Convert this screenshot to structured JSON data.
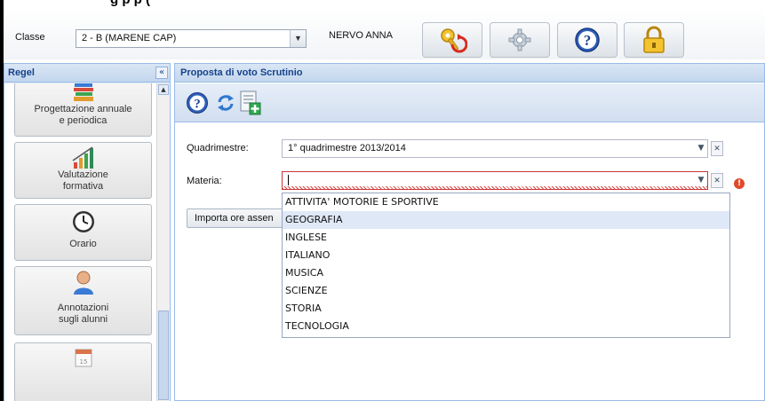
{
  "top_strip": {
    "text": "g          p                              p  ("
  },
  "header": {
    "classe_label": "Classe",
    "classe_value": "2 - B (MARENE CAP)",
    "teacher_name": "NERVO ANNA"
  },
  "left_panel": {
    "title": "Regel",
    "collapse": "«",
    "items": [
      {
        "label": "Progettazione annuale\ne periodica",
        "icon": "books-icon"
      },
      {
        "label": "Valutazione\nformativa",
        "icon": "growth-chart-icon"
      },
      {
        "label": "Orario",
        "icon": "clock-icon"
      },
      {
        "label": "Annotazioni\nsugli alunni",
        "icon": "student-icon"
      },
      {
        "label": "",
        "icon": "calendar-icon"
      }
    ]
  },
  "main_panel": {
    "title": "Proposta di voto Scrutinio",
    "form": {
      "quadrimestre_label": "Quadrimestre:",
      "quadrimestre_value": "1° quadrimestre 2013/2014",
      "materia_label": "Materia:",
      "materia_value": "",
      "import_label": "Importa ore assen"
    },
    "materia_options": [
      "ATTIVITA' MOTORIE E SPORTIVE",
      "GEOGRAFIA",
      "INGLESE",
      "ITALIANO",
      "MUSICA",
      "SCIENZE",
      "STORIA",
      "TECNOLOGIA"
    ],
    "highlighted_option": "GEOGRAFIA"
  },
  "colors": {
    "panel_border": "#99bbe8",
    "panel_title": "#15428b",
    "error": "#e04a2a",
    "highlight": "#dfe8f6"
  }
}
